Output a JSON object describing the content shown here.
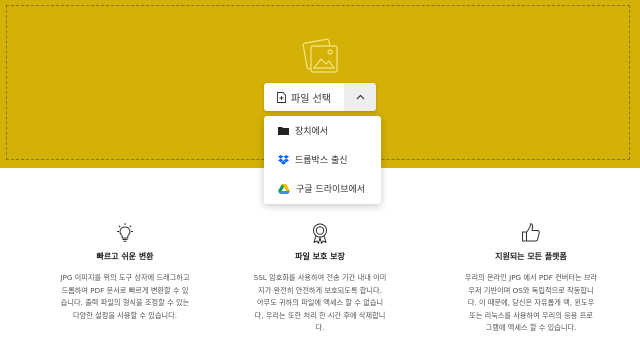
{
  "dropzone": {
    "background_color": "#d4b106",
    "hero_icon": "images-icon",
    "choose_button_label": "파일 선택",
    "choose_button_icon": "file-icon",
    "toggle_icon": "chevron-up-icon"
  },
  "source_menu": {
    "items": [
      {
        "label": "장치에서",
        "icon": "folder-icon"
      },
      {
        "label": "드롭박스 출신",
        "icon": "dropbox-icon"
      },
      {
        "label": "구글 드라이브에서",
        "icon": "google-drive-icon"
      }
    ]
  },
  "features": [
    {
      "icon": "lightbulb-icon",
      "title": "빠르고 쉬운 변환",
      "lines": [
        "JPG 이미지를 위의 도구 상자에 드래그하고",
        "드롭하여 PDF 문서로 빠르게 변환할 수 있",
        "습니다. 출력 파일의 형식을 조정할 수 있는",
        "다양한 설정을 사용할 수 있습니다."
      ]
    },
    {
      "icon": "badge-icon",
      "title": "파일 보호 보장",
      "lines": [
        "SSL 암호화를 사용하여 전송 기간 내내 이미",
        "지가 완전히 안전하게 보호되도록 합니다.",
        "아무도 귀하의 파일에 액세스 할 수 없습니",
        "다, 우리는 또한 처리 한 시간 후에 삭제합니",
        "다."
      ]
    },
    {
      "icon": "thumbs-up-icon",
      "title": "지원되는 모든 플랫폼",
      "lines": [
        "우리의 온라인 JPG 에서 PDF 컨버터는 브라",
        "우저 기반이며 OS와 독립적으로 작동합니",
        "다. 이 때문에, 당신은 자유롭게 맥, 윈도우",
        "또는 리눅스를 사용하여 우리의 응용 프로",
        "그램에 액세스 할 수 있습니다."
      ]
    }
  ]
}
